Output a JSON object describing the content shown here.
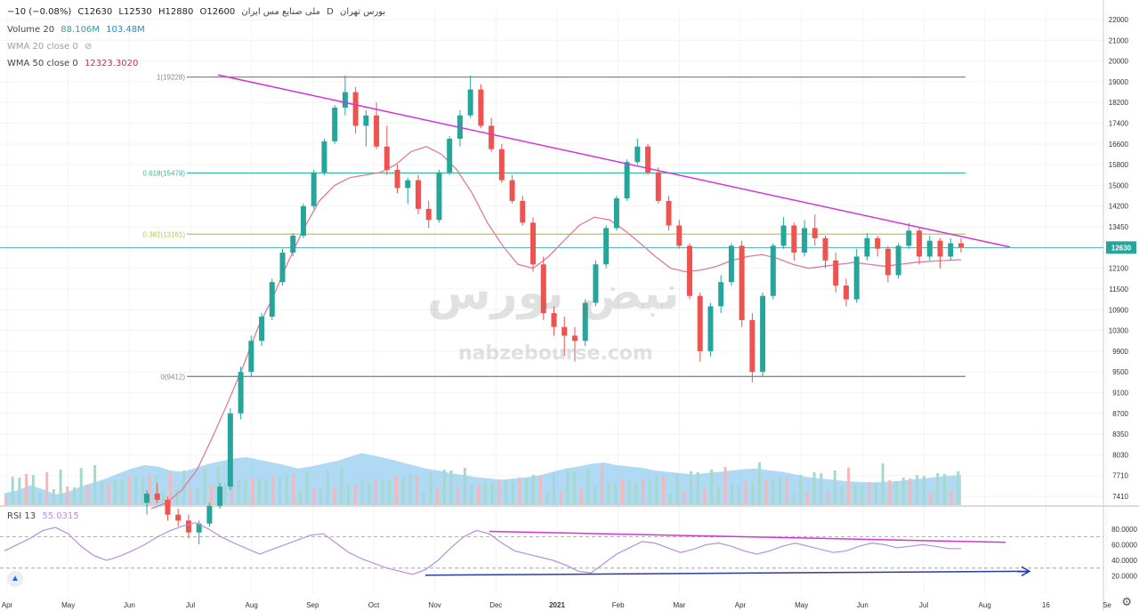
{
  "header": {
    "symbol": "ملی صنایع مس ایران",
    "exchange": "بورس تهران",
    "interval": "D",
    "ohlc": {
      "o": "O12600",
      "h": "H12880",
      "l": "L12530",
      "c": "C12630",
      "chg": "−10 (−0.08%)"
    },
    "volume_label": "Volume 20",
    "volume_v1": "88.106M",
    "volume_v2": "103.48M",
    "wma20_label": "WMA 20 close 0",
    "wma50_label": "WMA 50 close 0",
    "wma50_value": "12323.3020",
    "rsi_label": "RSI 13",
    "rsi_value": "55.0315"
  },
  "watermark": {
    "brand": "نبض بورس",
    "site": "nabzebourse.com"
  },
  "colors": {
    "up": "#26a69a",
    "down": "#ef5350",
    "trend": "#d633d6",
    "ma": "#e07a9a",
    "fib": "#888888",
    "fib618": "#3cb89b",
    "fib382": "#b6c94a",
    "rsi": "#b98fd8",
    "rsiSupport": "#2b3aa6",
    "vol": "#8ec9f0",
    "price_tag": "#26a69a"
  },
  "chart_data": [
    {
      "type": "candlestick",
      "x_ticks": [
        "Apr",
        "May",
        "Jun",
        "Jul",
        "Aug",
        "Sep",
        "Oct",
        "Nov",
        "Dec",
        "2021",
        "Feb",
        "Mar",
        "Apr",
        "May",
        "Jun",
        "Jul",
        "Aug",
        "16",
        "Se"
      ],
      "y_ticks": [
        7410,
        7710,
        8030,
        8350,
        8700,
        9100,
        9500,
        9900,
        10300,
        10900,
        11500,
        12100,
        12630,
        13450,
        14200,
        15000,
        15800,
        16600,
        17400,
        18200,
        19000,
        20000,
        21000,
        22000
      ],
      "last_price": 12630,
      "fib_levels": [
        {
          "label": "1(19228)",
          "value": 19228
        },
        {
          "label": "0.618(15478)",
          "value": 15478
        },
        {
          "label": "0.382(13161)",
          "value": 13161
        },
        {
          "label": "0(9412)",
          "value": 9412
        }
      ],
      "trendline": {
        "from": [
          0.24,
          19330
        ],
        "to": [
          0.97,
          12650
        ]
      },
      "candles": [
        [
          7300,
          7500,
          7100,
          7450
        ],
        [
          7450,
          7600,
          7300,
          7350
        ],
        [
          7350,
          7400,
          7000,
          7100
        ],
        [
          7100,
          7200,
          6900,
          7000
        ],
        [
          7000,
          7100,
          6700,
          6800
        ],
        [
          6800,
          7000,
          6600,
          6950
        ],
        [
          6950,
          7300,
          6900,
          7250
        ],
        [
          7250,
          7600,
          7200,
          7550
        ],
        [
          7550,
          8800,
          7500,
          8700
        ],
        [
          8700,
          9600,
          8600,
          9500
        ],
        [
          9500,
          10200,
          9400,
          10100
        ],
        [
          10100,
          10800,
          10000,
          10700
        ],
        [
          10700,
          11800,
          10600,
          11700
        ],
        [
          11700,
          12600,
          11600,
          12500
        ],
        [
          12500,
          13200,
          12400,
          13100
        ],
        [
          13100,
          14300,
          13000,
          14200
        ],
        [
          14200,
          15600,
          14100,
          15500
        ],
        [
          15500,
          16800,
          15400,
          16700
        ],
        [
          16700,
          18100,
          16600,
          18000
        ],
        [
          18000,
          19300,
          17700,
          18600
        ],
        [
          18600,
          18800,
          17000,
          17300
        ],
        [
          17300,
          17900,
          16500,
          17700
        ],
        [
          17700,
          18200,
          16400,
          16500
        ],
        [
          16500,
          17300,
          15400,
          15600
        ],
        [
          15600,
          15800,
          14700,
          14900
        ],
        [
          14900,
          15300,
          14300,
          15200
        ],
        [
          15200,
          15400,
          13900,
          14100
        ],
        [
          14100,
          14400,
          13400,
          13700
        ],
        [
          13700,
          15600,
          13600,
          15500
        ],
        [
          15500,
          16900,
          15400,
          16800
        ],
        [
          16800,
          17900,
          16500,
          17700
        ],
        [
          17700,
          19300,
          17600,
          18700
        ],
        [
          18700,
          18900,
          17200,
          17300
        ],
        [
          17300,
          17600,
          16300,
          16400
        ],
        [
          16400,
          16600,
          15100,
          15200
        ],
        [
          15200,
          15400,
          14300,
          14400
        ],
        [
          14400,
          14600,
          13500,
          13600
        ],
        [
          13600,
          13800,
          12000,
          12200
        ],
        [
          12200,
          12400,
          10600,
          10800
        ],
        [
          10800,
          11000,
          10200,
          10400
        ],
        [
          10400,
          10700,
          9800,
          10200
        ],
        [
          10200,
          10400,
          9700,
          10100
        ],
        [
          10100,
          11200,
          10000,
          11100
        ],
        [
          11100,
          12300,
          11000,
          12200
        ],
        [
          12200,
          13500,
          12100,
          13400
        ],
        [
          13400,
          14600,
          13300,
          14500
        ],
        [
          14500,
          16000,
          14400,
          15900
        ],
        [
          15900,
          16800,
          15800,
          16500
        ],
        [
          16500,
          16600,
          15400,
          15500
        ],
        [
          15500,
          15700,
          14300,
          14400
        ],
        [
          14400,
          14600,
          13300,
          13500
        ],
        [
          13500,
          13700,
          12600,
          12700
        ],
        [
          12700,
          12800,
          11200,
          11300
        ],
        [
          11300,
          11400,
          9700,
          9900
        ],
        [
          9900,
          11100,
          9800,
          11000
        ],
        [
          11000,
          11900,
          10800,
          11700
        ],
        [
          11700,
          12800,
          11600,
          12700
        ],
        [
          12700,
          12900,
          10400,
          10600
        ],
        [
          10600,
          10800,
          9300,
          9500
        ],
        [
          9500,
          11400,
          9400,
          11300
        ],
        [
          11300,
          12800,
          11200,
          12700
        ],
        [
          12700,
          13800,
          12600,
          13500
        ],
        [
          13500,
          13600,
          12300,
          12500
        ],
        [
          12500,
          13700,
          12400,
          13400
        ],
        [
          13400,
          13900,
          12700,
          13000
        ],
        [
          13000,
          13100,
          12100,
          12300
        ],
        [
          12300,
          12500,
          11400,
          11600
        ],
        [
          11600,
          11800,
          11000,
          11200
        ],
        [
          11200,
          12600,
          11100,
          12400
        ],
        [
          12400,
          13200,
          12300,
          13000
        ],
        [
          13000,
          13100,
          12400,
          12600
        ],
        [
          12600,
          12700,
          11700,
          11900
        ],
        [
          11900,
          12800,
          11800,
          12700
        ],
        [
          12700,
          13600,
          12600,
          13300
        ],
        [
          13300,
          13400,
          12200,
          12400
        ],
        [
          12400,
          13100,
          12300,
          12900
        ],
        [
          12900,
          13000,
          12100,
          12400
        ],
        [
          12400,
          13000,
          12300,
          12800
        ],
        [
          12800,
          13000,
          12500,
          12630
        ]
      ],
      "wma50": [
        7200,
        7300,
        7500,
        7800,
        8300,
        8900,
        9600,
        10400,
        11300,
        12300,
        13400,
        14400,
        15000,
        15300,
        15400,
        15500,
        15800,
        16300,
        16500,
        16200,
        15600,
        14700,
        13600,
        12700,
        12200,
        12100,
        12400,
        12900,
        13500,
        13800,
        13700,
        13300,
        12800,
        12400,
        12100,
        12000,
        12050,
        12150,
        12300,
        12400,
        12450,
        12350,
        12200,
        12100,
        12150,
        12200,
        12250,
        12200,
        12150,
        12200,
        12250,
        12280,
        12300,
        12323
      ]
    },
    {
      "type": "bar",
      "title": "Volume",
      "series": [
        {
          "name": "Volume 20",
          "values": [
            18,
            22,
            30,
            24,
            16,
            20,
            28,
            34,
            40,
            48,
            55,
            60,
            58,
            52,
            50,
            56,
            62,
            66,
            70,
            72,
            68,
            64,
            60,
            55,
            58,
            62,
            66,
            72,
            78,
            74,
            70,
            65,
            60,
            55,
            52,
            48,
            45,
            42,
            40,
            38,
            40,
            42,
            45,
            50,
            55,
            58,
            62,
            64,
            60,
            58,
            56,
            52,
            50,
            48,
            46,
            48,
            50,
            52,
            54,
            55,
            52,
            50,
            46,
            42,
            40,
            38,
            36,
            35,
            34,
            35,
            36,
            38,
            40,
            42,
            44,
            45
          ]
        }
      ]
    },
    {
      "type": "line",
      "title": "RSI 13",
      "y_ticks": [
        20,
        40,
        60,
        80
      ],
      "levels": [
        70,
        30
      ],
      "series": [
        {
          "name": "RSI 13",
          "values": [
            52,
            60,
            68,
            78,
            82,
            74,
            58,
            46,
            40,
            45,
            52,
            60,
            70,
            78,
            84,
            88,
            80,
            70,
            62,
            55,
            48,
            54,
            60,
            66,
            72,
            74,
            62,
            50,
            42,
            36,
            30,
            26,
            22,
            28,
            40,
            56,
            70,
            78,
            74,
            62,
            52,
            48,
            44,
            40,
            34,
            26,
            24,
            36,
            48,
            56,
            64,
            62,
            56,
            50,
            54,
            60,
            62,
            58,
            52,
            48,
            52,
            58,
            62,
            58,
            54,
            50,
            52,
            58,
            62,
            60,
            56,
            58,
            60,
            58,
            55,
            55
          ]
        }
      ],
      "resistance": {
        "from": [
          0.43,
          77
        ],
        "to": [
          0.88,
          63
        ]
      },
      "support": {
        "from": [
          0.37,
          21
        ],
        "to": [
          0.9,
          26
        ]
      }
    }
  ]
}
